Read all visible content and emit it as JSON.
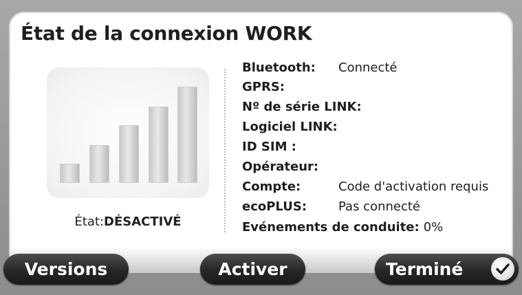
{
  "header": {
    "title": "État de la connexion WORK"
  },
  "signal": {
    "bars_total": 5,
    "status_label": "État:",
    "status_value": "DÉSACTIVÉ"
  },
  "details": [
    {
      "label": "Bluetooth:",
      "value": "Connecté"
    },
    {
      "label": "GPRS:",
      "value": ""
    },
    {
      "label": "Nº de série LINK:",
      "value": ""
    },
    {
      "label": "Logiciel LINK:",
      "value": ""
    },
    {
      "label": "ID SIM :",
      "value": ""
    },
    {
      "label": "Opérateur:",
      "value": ""
    },
    {
      "label": "Compte:",
      "value": "Code d'activation requis"
    },
    {
      "label": "ecoPLUS:",
      "value": "Pas connecté"
    },
    {
      "label": "Evénements de conduite:",
      "value": "0%"
    }
  ],
  "buttons": {
    "versions": "Versions",
    "activate": "Activer",
    "done": "Terminé"
  },
  "icons": {
    "done": "checkmark-icon",
    "signal": "signal-bars-icon"
  },
  "colors": {
    "button_bg": "#262626",
    "panel_bg": "#ffffff",
    "bar": "#d6d6d6"
  }
}
